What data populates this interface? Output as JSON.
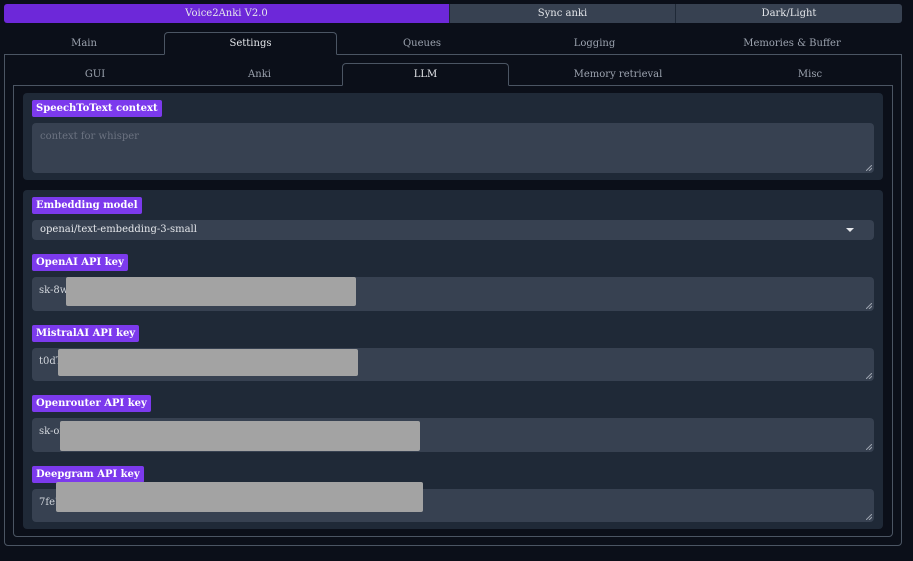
{
  "topbar": {
    "title": "Voice2Anki V2.0",
    "sync": "Sync anki",
    "theme": "Dark/Light"
  },
  "main_tabs": [
    "Main",
    "Settings",
    "Queues",
    "Logging",
    "Memories & Buffer"
  ],
  "sub_tabs": [
    "GUI",
    "Anki",
    "LLM",
    "Memory retrieval",
    "Misc"
  ],
  "stt": {
    "label": "SpeechToText context",
    "placeholder": "context for whisper"
  },
  "embedding": {
    "label": "Embedding model",
    "value": "openai/text-embedding-3-small"
  },
  "openai": {
    "label": "OpenAI API key",
    "value": "sk-8wv"
  },
  "mistral": {
    "label": "MistralAI API key",
    "value": "t0dT"
  },
  "openrouter": {
    "label": "Openrouter API key",
    "value": "sk-or"
  },
  "deepgram": {
    "label": "Deepgram API key",
    "value": "7fe7"
  },
  "colors": {
    "accent": "#7c3aed",
    "primary": "#6d28d9",
    "field": "#374151",
    "panel": "#1f2937",
    "bg": "#0b0f19"
  }
}
